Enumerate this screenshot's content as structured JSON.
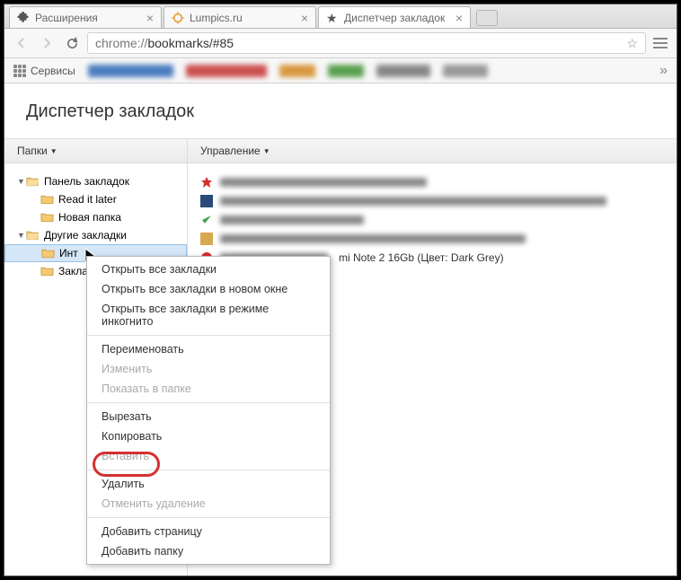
{
  "tabs": [
    {
      "label": "Расширения",
      "active": false
    },
    {
      "label": "Lumpics.ru",
      "active": false
    },
    {
      "label": "Диспетчер закладок",
      "active": true
    }
  ],
  "omnibox": {
    "host": "chrome://",
    "path": "bookmarks/#85"
  },
  "bookmarks_bar": {
    "services": "Сервисы"
  },
  "page": {
    "title": "Диспетчер закладок"
  },
  "columns": {
    "folders": "Папки",
    "manage": "Управление"
  },
  "tree": {
    "bookmark_bar": "Панель закладок",
    "read_later": "Read it later",
    "new_folder": "Новая папка",
    "other_bookmarks": "Другие закладки",
    "int": "Инт",
    "zaklad": "Заклад"
  },
  "list": {
    "item5": "mi Note 2 16Gb (Цвет: Dark Grey)"
  },
  "context_menu": {
    "open_all": "Открыть все закладки",
    "open_all_new": "Открыть все закладки в новом окне",
    "open_all_incognito": "Открыть все закладки в режиме инкогнито",
    "rename": "Переименовать",
    "edit": "Изменить",
    "show_in_folder": "Показать в папке",
    "cut": "Вырезать",
    "copy": "Копировать",
    "paste": "Вставить",
    "delete": "Удалить",
    "undo_delete": "Отменить удаление",
    "add_page": "Добавить страницу",
    "add_folder": "Добавить папку"
  }
}
